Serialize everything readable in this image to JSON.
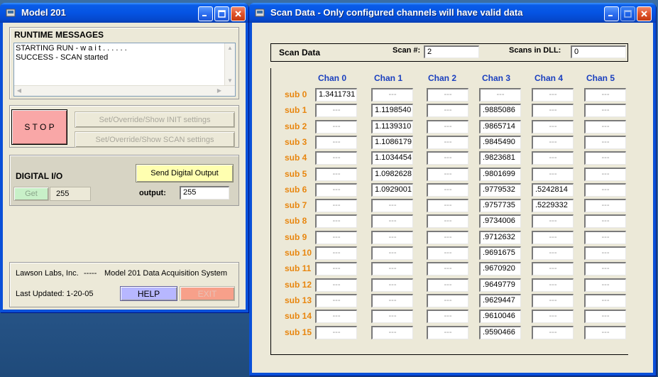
{
  "model_window": {
    "title": "Model 201",
    "runtime": {
      "heading": "RUNTIME MESSAGES",
      "lines": [
        "STARTING RUN - w a i t . . . . . .",
        "SUCCESS - SCAN started"
      ]
    },
    "stop_label": "S T O P",
    "init_label": "Set/Override/Show INIT settings",
    "scan_label": "Set/Override/Show SCAN  settings",
    "digital": {
      "heading": "DIGITAL I/O",
      "get_label": "Get",
      "get_value": "255",
      "send_label": "Send Digital Output",
      "output_label": "output:",
      "output_value": "255"
    },
    "footer": {
      "company": "Lawson Labs, Inc.",
      "separator": "-----",
      "product": "Model 201 Data Acquisition System",
      "updated": "Last Updated: 1-20-05",
      "help_label": "HELP",
      "exit_label": "EXIT"
    }
  },
  "scan_window": {
    "title": "Scan Data - Only configured channels will have valid data",
    "header": {
      "label": "Scan Data",
      "scan_num_label": "Scan #:",
      "scan_num_value": "2",
      "scans_dll_label": "Scans in DLL:",
      "scans_dll_value": "0"
    },
    "empty_value": "---",
    "channels": [
      "Chan 0",
      "Chan 1",
      "Chan 2",
      "Chan 3",
      "Chan 4",
      "Chan 5"
    ],
    "subs": [
      "sub 0",
      "sub 1",
      "sub 2",
      "sub 3",
      "sub 4",
      "sub 5",
      "sub 6",
      "sub 7",
      "sub 8",
      "sub 9",
      "sub 10",
      "sub 11",
      "sub 12",
      "sub 13",
      "sub 14",
      "sub 15"
    ],
    "grid": [
      [
        "1.3411731",
        "---",
        "---",
        "---",
        "---",
        "---"
      ],
      [
        "---",
        "1.1198540",
        "---",
        ".9885086",
        "---",
        "---"
      ],
      [
        "---",
        "1.1139310",
        "---",
        ".9865714",
        "---",
        "---"
      ],
      [
        "---",
        "1.1086179",
        "---",
        ".9845490",
        "---",
        "---"
      ],
      [
        "---",
        "1.1034454",
        "---",
        ".9823681",
        "---",
        "---"
      ],
      [
        "---",
        "1.0982628",
        "---",
        ".9801699",
        "---",
        "---"
      ],
      [
        "---",
        "1.0929001",
        "---",
        ".9779532",
        ".5242814",
        "---"
      ],
      [
        "---",
        "---",
        "---",
        ".9757735",
        ".5229332",
        "---"
      ],
      [
        "---",
        "---",
        "---",
        ".9734006",
        "---",
        "---"
      ],
      [
        "---",
        "---",
        "---",
        ".9712632",
        "---",
        "---"
      ],
      [
        "---",
        "---",
        "---",
        ".9691675",
        "---",
        "---"
      ],
      [
        "---",
        "---",
        "---",
        ".9670920",
        "---",
        "---"
      ],
      [
        "---",
        "---",
        "---",
        ".9649779",
        "---",
        "---"
      ],
      [
        "---",
        "---",
        "---",
        ".9629447",
        "---",
        "---"
      ],
      [
        "---",
        "---",
        "---",
        ".9610046",
        "---",
        "---"
      ],
      [
        "---",
        "---",
        "---",
        ".9590466",
        "---",
        "---"
      ]
    ]
  },
  "colors": {
    "stop": "#f9a7a7",
    "send": "#ffffb0",
    "get": "#c8f0c8",
    "help": "#b7b7ff",
    "exit": "#f7a08a",
    "chan_head": "#1a3fbf",
    "sub_label": "#e8860f"
  }
}
